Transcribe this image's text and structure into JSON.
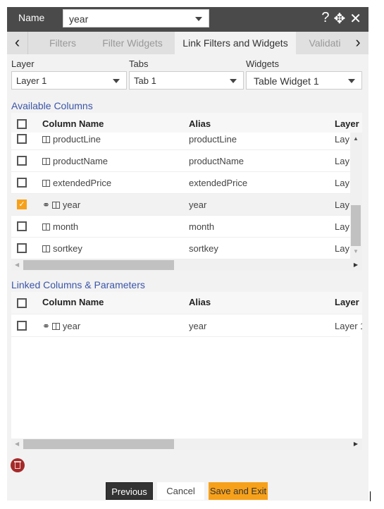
{
  "header": {
    "name_label": "Name",
    "name_value": "year",
    "icons": [
      "help-icon",
      "move-icon",
      "close-icon"
    ]
  },
  "tabs": [
    {
      "label": "Filters"
    },
    {
      "label": "Filter Widgets"
    },
    {
      "label": "Link Filters and Widgets",
      "active": true
    },
    {
      "label": "Validati"
    }
  ],
  "fields": {
    "layer": {
      "label": "Layer",
      "value": "Layer 1"
    },
    "tabs": {
      "label": "Tabs",
      "value": "Tab 1"
    },
    "widgets": {
      "label": "Widgets",
      "value": "Table Widget 1"
    }
  },
  "available": {
    "title": "Available Columns",
    "headers": {
      "name": "Column Name",
      "alias": "Alias",
      "layer": "Layer"
    },
    "rows": [
      {
        "name": "productLine",
        "alias": "productLine",
        "layer": "Lay",
        "checked": false,
        "linked": false
      },
      {
        "name": "productName",
        "alias": "productName",
        "layer": "Lay",
        "checked": false,
        "linked": false
      },
      {
        "name": "extendedPrice",
        "alias": "extendedPrice",
        "layer": "Lay",
        "checked": false,
        "linked": false
      },
      {
        "name": "year",
        "alias": "year",
        "layer": "Lay",
        "checked": true,
        "linked": true
      },
      {
        "name": "month",
        "alias": "month",
        "layer": "Lay",
        "checked": false,
        "linked": false
      },
      {
        "name": "sortkey",
        "alias": "sortkey",
        "layer": "Lay",
        "checked": false,
        "linked": false
      }
    ]
  },
  "linked": {
    "title": "Linked Columns & Parameters",
    "headers": {
      "name": "Column Name",
      "alias": "Alias",
      "layer": "Layer"
    },
    "rows": [
      {
        "name": "year",
        "alias": "year",
        "layer": "Layer 1",
        "checked": false,
        "linked": true
      }
    ]
  },
  "footer": {
    "previous": "Previous",
    "cancel": "Cancel",
    "save": "Save and Exit"
  },
  "colors": {
    "header": "#4a4a4a",
    "accent": "#f7a11a",
    "link_title": "#3b55a8",
    "delete": "#a52a2a"
  }
}
